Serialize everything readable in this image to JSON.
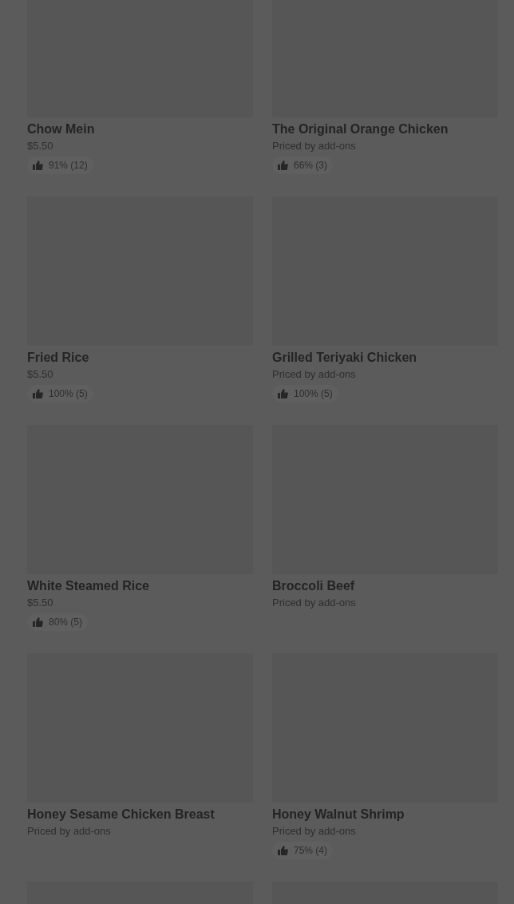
{
  "items": [
    {
      "kind": "product",
      "name": "Chow Mein",
      "price": "$5.50",
      "rating": "91% (12)"
    },
    {
      "kind": "product",
      "name": "The Original Orange Chicken",
      "price": "Priced by add-ons",
      "rating": "66% (3)"
    },
    {
      "kind": "product",
      "name": "Fried Rice",
      "price": "$5.50",
      "rating": "100% (5)"
    },
    {
      "kind": "product",
      "name": "Grilled Teriyaki Chicken",
      "price": "Priced by add-ons",
      "rating": "100% (5)"
    },
    {
      "kind": "product",
      "name": "White Steamed Rice",
      "price": "$5.50",
      "rating": "80% (5)"
    },
    {
      "kind": "product",
      "name": "Broccoli Beef",
      "price": "Priced by add-ons"
    },
    {
      "kind": "product",
      "name": "Honey Sesame Chicken Breast",
      "price": "Priced by add-ons"
    },
    {
      "kind": "product",
      "name": "Honey Walnut Shrimp",
      "price": "Priced by add-ons",
      "rating": "75% (4)"
    },
    {
      "kind": "cut-off"
    },
    {
      "kind": "cut-off"
    }
  ]
}
